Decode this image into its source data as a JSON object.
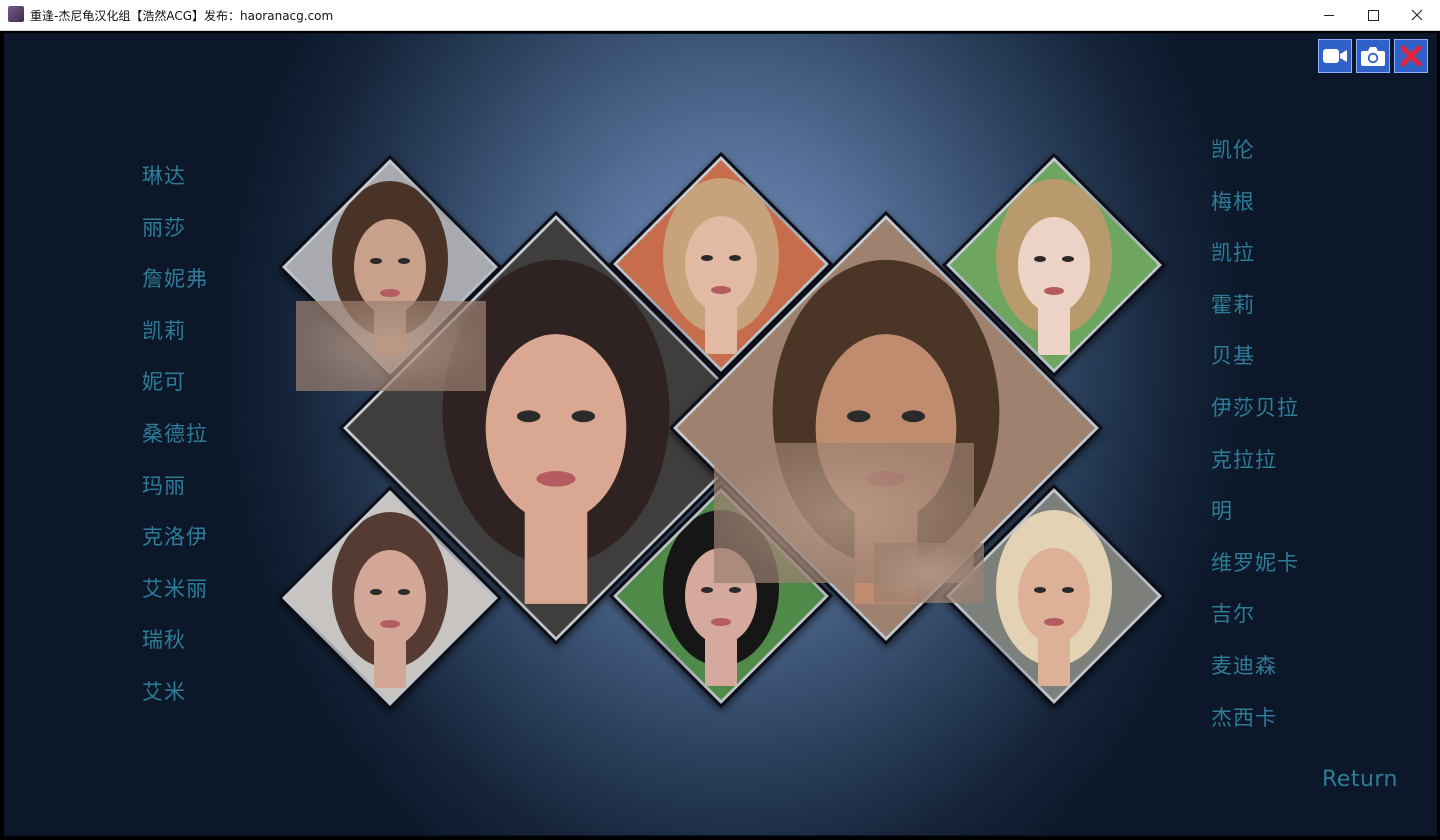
{
  "window": {
    "title": "重逢-杰尼龟汉化组【浩然ACG】发布：haoranacg.com",
    "minimize_icon": "minimize-icon",
    "maximize_icon": "maximize-icon",
    "close_icon": "close-icon"
  },
  "toolbar": {
    "buttons": [
      {
        "name": "record-video-button",
        "icon": "video-camera-icon"
      },
      {
        "name": "screenshot-button",
        "icon": "camera-icon"
      },
      {
        "name": "close-gallery-button",
        "icon": "red-x-icon"
      }
    ],
    "accent": "#2f61c8",
    "close_color": "#e0243c"
  },
  "characters_left": [
    "琳达",
    "丽莎",
    "詹妮弗",
    "凯莉",
    "妮可",
    "桑德拉",
    "玛丽",
    "克洛伊",
    "艾米丽",
    "瑞秋",
    "艾米"
  ],
  "characters_right": [
    "凯伦",
    "梅根",
    "凯拉",
    "霍莉",
    "贝基",
    "伊莎贝拉",
    "克拉拉",
    "明",
    "维罗妮卡",
    "吉尔",
    "麦迪森",
    "杰西卡"
  ],
  "return_label": "Return",
  "name_color": "#2e7c98",
  "portraits": [
    {
      "name": "portrait-brunette-bob",
      "hair": "#4a3326",
      "skin": "#c9a08a",
      "bg": "#a8aab0"
    },
    {
      "name": "portrait-blonde-tie",
      "hair": "#c7a27a",
      "skin": "#e2b9a3",
      "bg": "#c76d4e"
    },
    {
      "name": "portrait-short-blonde",
      "hair": "#b99a6c",
      "skin": "#ecd3c6",
      "bg": "#6ea55e"
    },
    {
      "name": "portrait-large-brunette",
      "hair": "#2e2420",
      "skin": "#d9a792",
      "bg": "#3f3c3c"
    },
    {
      "name": "portrait-two-women",
      "hair": "#4c3528",
      "skin": "#c08c70",
      "bg": "#9f8170"
    },
    {
      "name": "portrait-long-brown-hair",
      "hair": "#553b30",
      "skin": "#d2a797",
      "bg": "#c8c4c2"
    },
    {
      "name": "portrait-black-hair-glasses",
      "hair": "#151515",
      "skin": "#d6a99e",
      "bg": "#4f8a4a"
    },
    {
      "name": "portrait-platinum-blonde",
      "hair": "#e3d2b4",
      "skin": "#ddb197",
      "bg": "#7b7f7a"
    }
  ]
}
